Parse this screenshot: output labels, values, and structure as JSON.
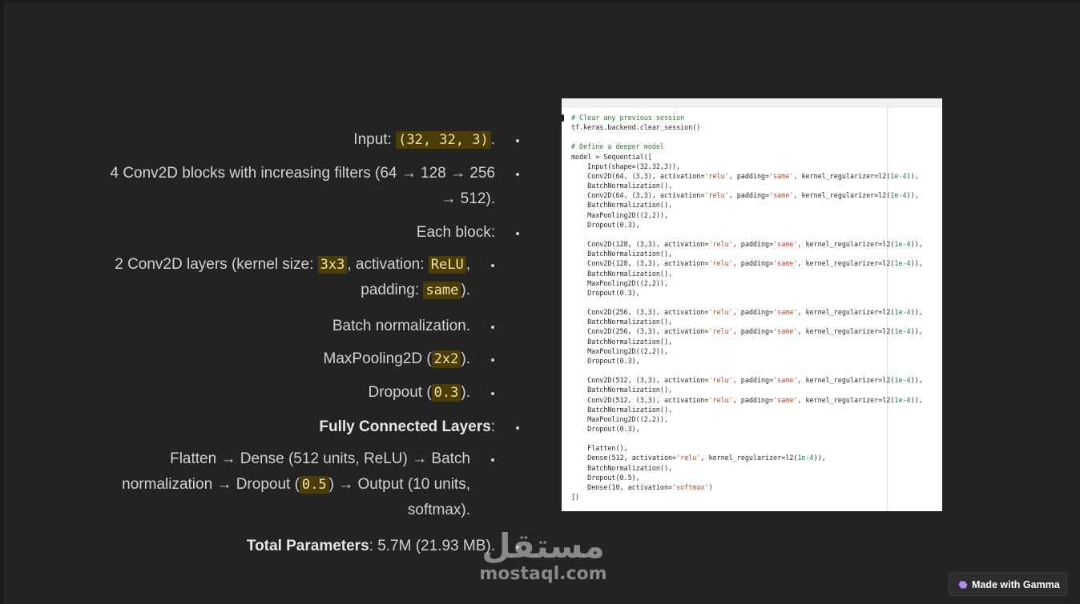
{
  "bullets": {
    "input": {
      "prefix": "Input: ",
      "code": "(32, 32, 3)",
      "suffix": "."
    },
    "conv_blocks": {
      "line1": "4 Conv2D blocks with increasing filters (64 → 128 → 256",
      "line2": "→ 512)."
    },
    "each_block": "Each block:",
    "conv_layers": {
      "line1_prefix": "2 Conv2D layers (kernel size: ",
      "kernel": "3x3",
      "line1_mid": ", activation: ",
      "activation": "ReLU",
      "line1_suffix": ",",
      "line2_prefix": "padding: ",
      "padding": "same",
      "line2_suffix": ")."
    },
    "batch_norm": "Batch normalization.",
    "maxpool": {
      "prefix": "MaxPooling2D (",
      "code": "2x2",
      "suffix": ")."
    },
    "dropout": {
      "prefix": "Dropout (",
      "code": "0.3",
      "suffix": ")."
    },
    "fully_connected": {
      "bold": "Fully Connected Layers",
      "suffix": ":"
    },
    "flatten": {
      "line1": "Flatten → Dense (512 units, ReLU) → Batch",
      "line2_prefix": "normalization → Dropout (",
      "code": "0.5",
      "line2_suffix": ") → Output (10 units,",
      "line3": "softmax)."
    },
    "total_params": {
      "bold": "Total Parameters",
      "rest": ": 5.7M (21.93 MB)."
    }
  },
  "code_screenshot": {
    "lines": [
      "# Clear any previous session",
      "tf.keras.backend.clear_session()",
      "",
      "# Define a deeper model",
      "model = Sequential([",
      "    Input(shape=(32,32,3)),",
      "    Conv2D(64, (3,3), activation='relu', padding='same', kernel_regularizer=l2(1e-4)),",
      "    BatchNormalization(),",
      "    Conv2D(64, (3,3), activation='relu', padding='same', kernel_regularizer=l2(1e-4)),",
      "    BatchNormalization(),",
      "    MaxPooling2D((2,2)),",
      "    Dropout(0.3),",
      "",
      "    Conv2D(128, (3,3), activation='relu', padding='same', kernel_regularizer=l2(1e-4)),",
      "    BatchNormalization(),",
      "    Conv2D(128, (3,3), activation='relu', padding='same', kernel_regularizer=l2(1e-4)),",
      "    BatchNormalization(),",
      "    MaxPooling2D((2,2)),",
      "    Dropout(0.3),",
      "",
      "    Conv2D(256, (3,3), activation='relu', padding='same', kernel_regularizer=l2(1e-4)),",
      "    BatchNormalization(),",
      "    Conv2D(256, (3,3), activation='relu', padding='same', kernel_regularizer=l2(1e-4)),",
      "    BatchNormalization(),",
      "    MaxPooling2D((2,2)),",
      "    Dropout(0.3),",
      "",
      "    Conv2D(512, (3,3), activation='relu', padding='same', kernel_regularizer=l2(1e-4)),",
      "    BatchNormalization(),",
      "    Conv2D(512, (3,3), activation='relu', padding='same', kernel_regularizer=l2(1e-4)),",
      "    BatchNormalization(),",
      "    MaxPooling2D((2,2)),",
      "    Dropout(0.3),",
      "",
      "    Flatten(),",
      "    Dense(512, activation='relu', kernel_regularizer=l2(1e-4)),",
      "    BatchNormalization(),",
      "    Dropout(0.5),",
      "    Dense(10, activation='softmax')",
      "])"
    ]
  },
  "watermark": {
    "arabic": "مستقل",
    "latin": "mostaql.com"
  },
  "badge": {
    "label": "Made with Gamma",
    "icon": "gamma-logo-icon"
  }
}
